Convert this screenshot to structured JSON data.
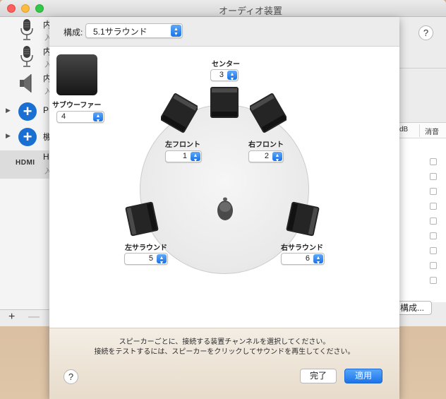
{
  "window": {
    "title": "オーディオ装置"
  },
  "devices": [
    {
      "name": "内",
      "sub": "入",
      "icon": "microphone-icon"
    },
    {
      "name": "内",
      "sub": "入",
      "icon": "microphone-icon"
    },
    {
      "name": "内",
      "sub": "入",
      "icon": "speaker-icon"
    },
    {
      "name": "P",
      "sub": "",
      "icon": "plus-icon"
    },
    {
      "name": "機",
      "sub": "",
      "icon": "plus-icon"
    },
    {
      "name": "H",
      "sub": "入",
      "icon": "hdmi-icon",
      "badge": "HDMI",
      "selected": true
    }
  ],
  "toolbar": {
    "add": "+",
    "remove": "—"
  },
  "help": "?",
  "table": {
    "col_db": "dB",
    "col_mute": "消音",
    "rows": 9
  },
  "configure_button": "構成...",
  "sheet": {
    "config_label": "構成:",
    "config_value": "5.1サラウンド",
    "speakers": {
      "center": {
        "label": "センター",
        "value": "3"
      },
      "subwoofer": {
        "label": "サブウーファー",
        "value": "4"
      },
      "front_left": {
        "label": "左フロント",
        "value": "1"
      },
      "front_right": {
        "label": "右フロント",
        "value": "2"
      },
      "surround_left": {
        "label": "左サラウンド",
        "value": "5"
      },
      "surround_right": {
        "label": "右サラウンド",
        "value": "6"
      }
    },
    "info_line1": "スピーカーごとに、接続する装置チャンネルを選択してください。",
    "info_line2": "接続をテストするには、スピーカーをクリックしてサウンドを再生してください。",
    "done_button": "完了",
    "apply_button": "適用"
  },
  "colors": {
    "accent": "#1a72e8",
    "footer": "#e8dccb",
    "desktop": "#d3b59a"
  }
}
